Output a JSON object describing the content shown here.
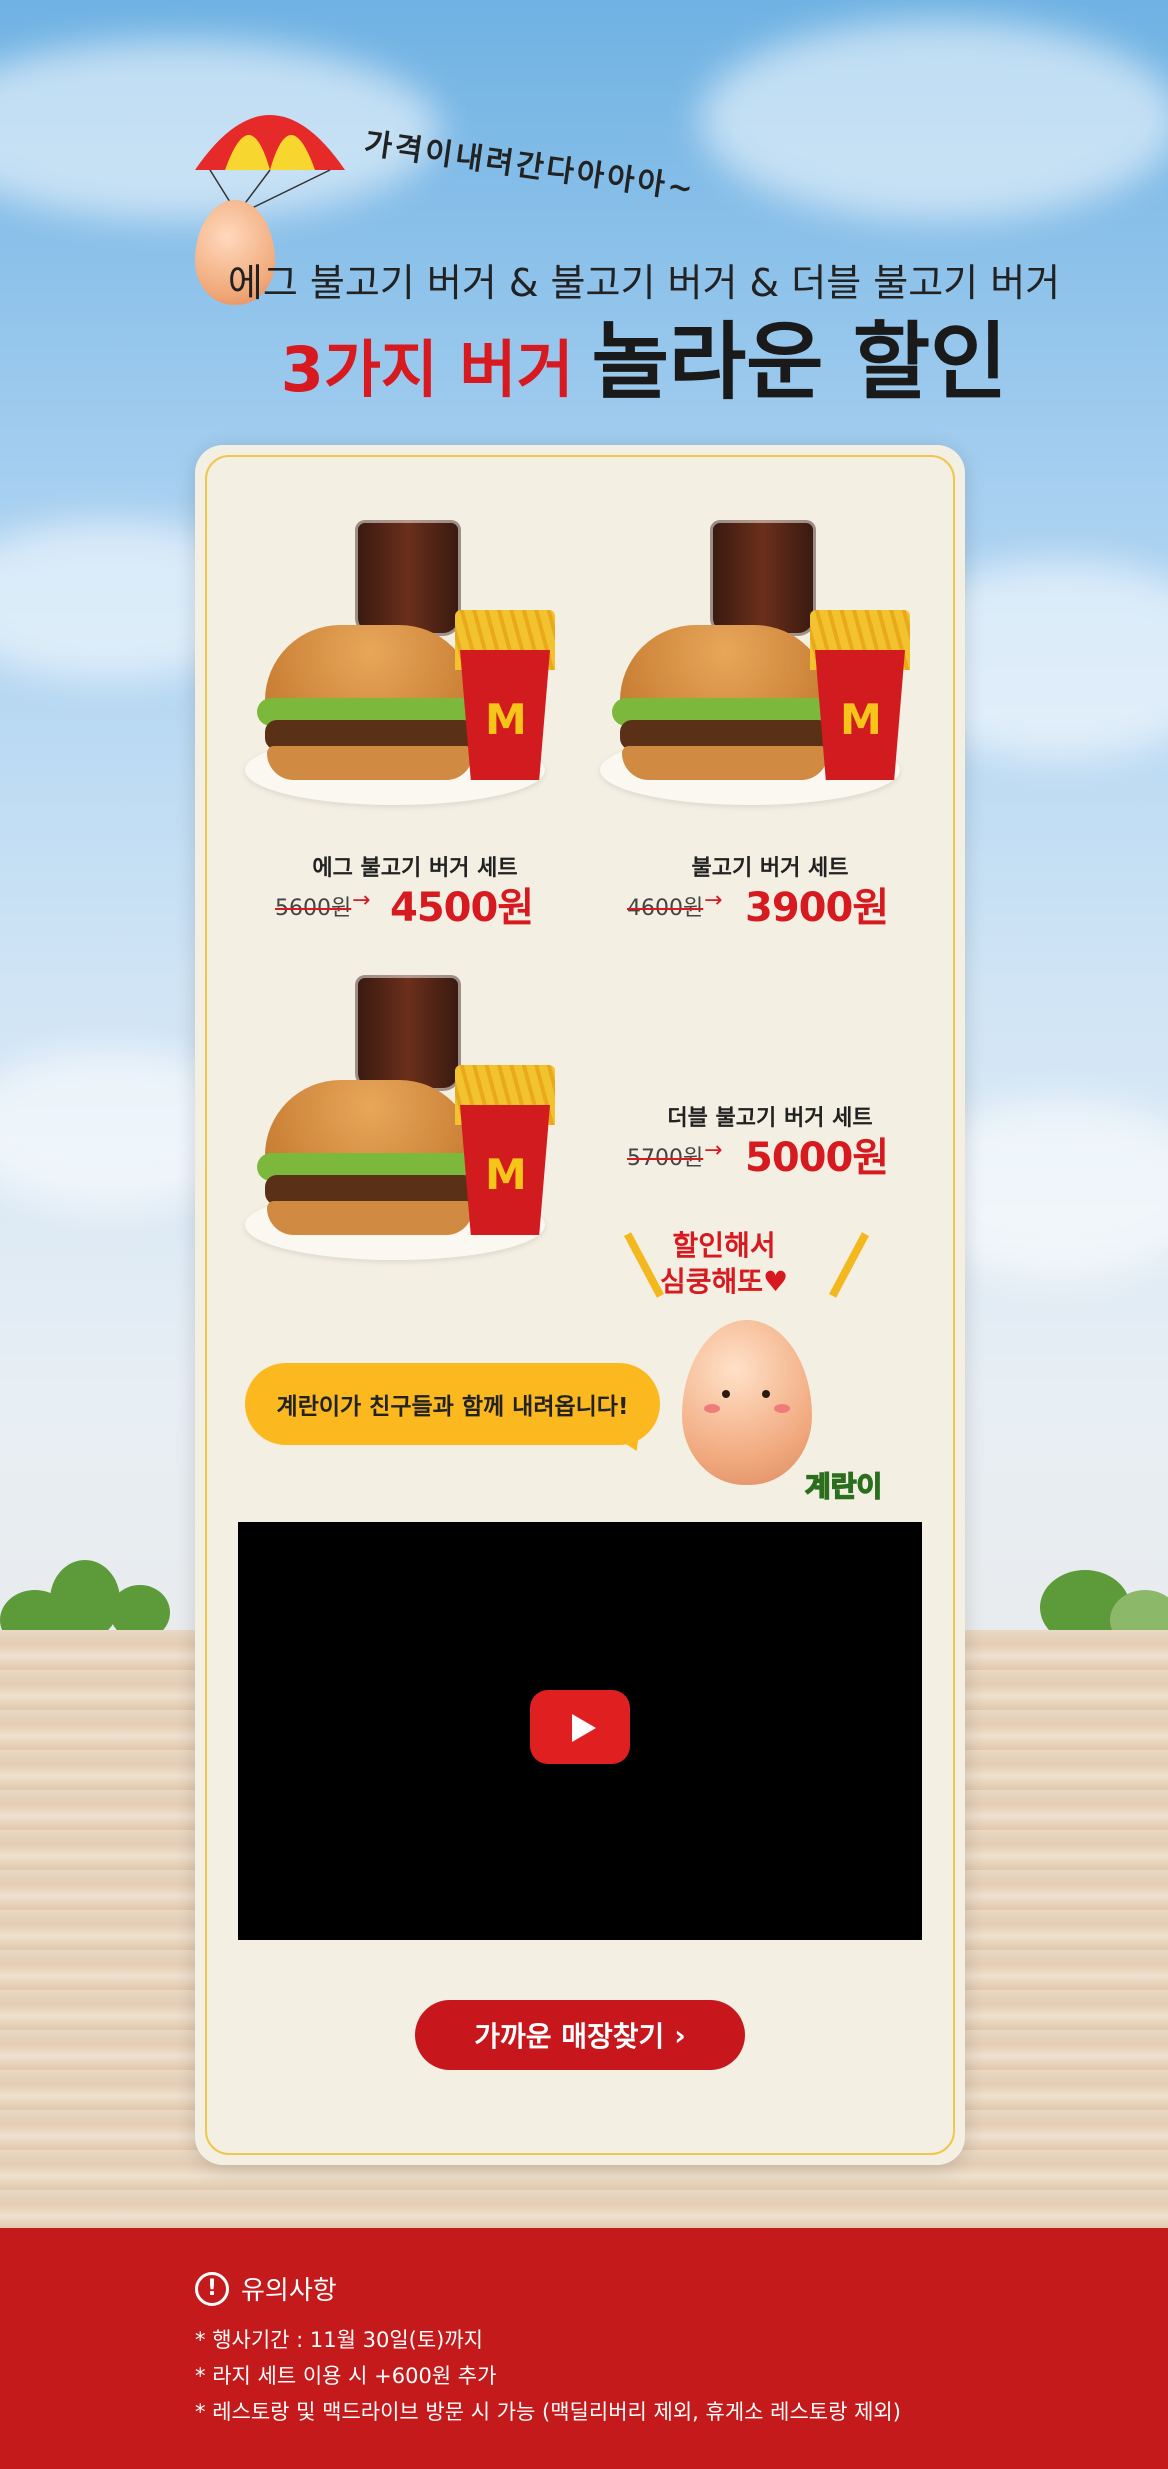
{
  "header": {
    "tagline": "가격이내려간다아아아~",
    "subtitle": "에그 불고기 버거 & 불고기 버거 & 더블 불고기 버거",
    "headline_red": "3가지 버거",
    "headline_black": "놀라운 할인"
  },
  "products": [
    {
      "name": "에그 불고기 버거 세트",
      "old_price": "5600원",
      "new_price": "4500원"
    },
    {
      "name": "불고기 버거 세트",
      "old_price": "4600원",
      "new_price": "3900원"
    },
    {
      "name": "더블 불고기 버거 세트",
      "old_price": "5700원",
      "new_price": "5000원"
    }
  ],
  "egg_shout": {
    "line1": "할인해서",
    "line2": "심쿵해또♥"
  },
  "speech_bubble": "계란이가 친구들과 함께 내려옵니다!",
  "mascot_name": "계란이",
  "store_button": {
    "label": "가까운 매장찾기",
    "icon": "chevron-right-icon"
  },
  "notice": {
    "title": "유의사항",
    "icon": "exclamation-circle-icon",
    "items": [
      "행사기간 : 11월 30일(토)까지",
      "라지 세트 이용 시 +600원 추가",
      "레스토랑 및 맥드라이브 방문 시 가능 (맥딜리버리 제외, 휴게소 레스토랑 제외)"
    ]
  },
  "colors": {
    "brand_red": "#d71920",
    "accent_yellow": "#fbb91f",
    "footer_red": "#c51a1b"
  }
}
